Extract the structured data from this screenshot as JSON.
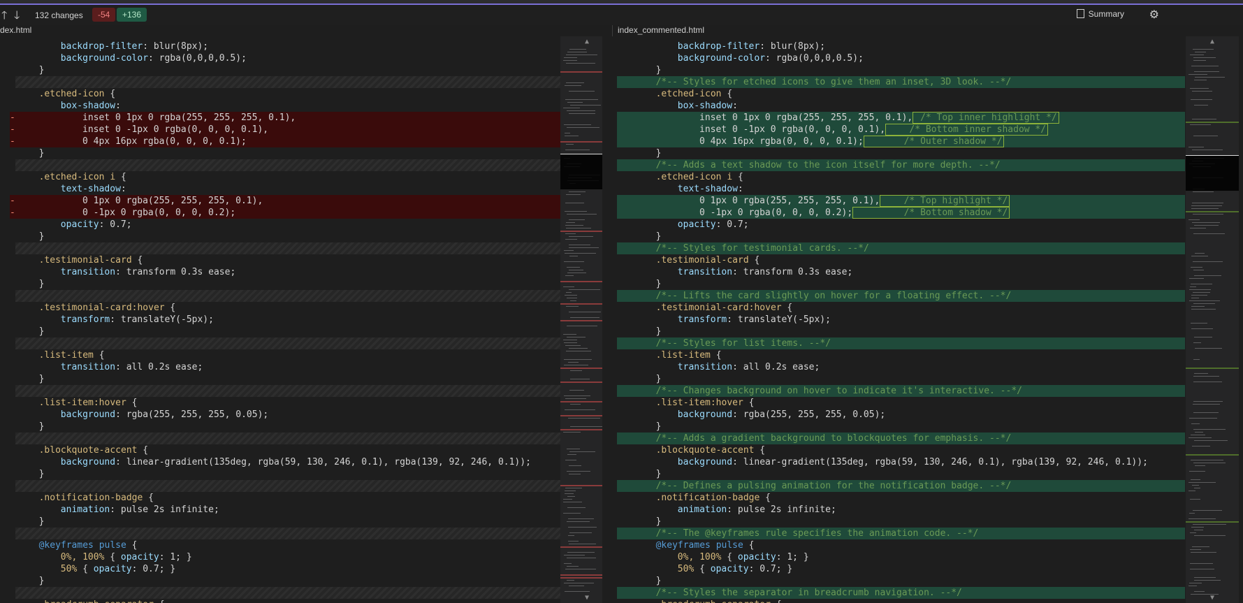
{
  "toolbar": {
    "up_arrow": "🡑",
    "down_arrow": "🡓",
    "changes_label": "132 changes",
    "deletions": "-54",
    "additions": "+136",
    "summary_label": "Summary",
    "settings_icon": "⚙"
  },
  "left": {
    "title": "dex.html",
    "lines": [
      {
        "kind": "ctx",
        "indent": 4,
        "html": "<span class=\"prop\">backdrop-filter</span>: blur(8px);"
      },
      {
        "kind": "ctx",
        "indent": 4,
        "html": "<span class=\"prop\">background-color</span>: rgba(0,0,0,0.5);"
      },
      {
        "kind": "ctx",
        "indent": 3,
        "html": "}"
      },
      {
        "kind": "hatch"
      },
      {
        "kind": "ctx",
        "indent": 3,
        "html": "<span class=\"sel\">.etched-icon</span> {"
      },
      {
        "kind": "ctx",
        "indent": 4,
        "html": "<span class=\"prop\">box-shadow</span>:"
      },
      {
        "kind": "del",
        "indent": 5,
        "html": "inset 0 1px 0 rgba(255, 255, 255, 0.1),"
      },
      {
        "kind": "del",
        "indent": 5,
        "html": "inset 0 -1px 0 rgba(0, 0, 0, 0.1),"
      },
      {
        "kind": "del",
        "indent": 5,
        "html": "0 4px 16px rgba(0, 0, 0, 0.1);"
      },
      {
        "kind": "ctx",
        "indent": 3,
        "html": "}"
      },
      {
        "kind": "hatch"
      },
      {
        "kind": "ctx",
        "indent": 3,
        "html": "<span class=\"sel\">.etched-icon i</span> {"
      },
      {
        "kind": "ctx",
        "indent": 4,
        "html": "<span class=\"prop\">text-shadow</span>:"
      },
      {
        "kind": "del",
        "indent": 5,
        "html": "0 1px 0 rgba(255, 255, 255, 0.1),"
      },
      {
        "kind": "del",
        "indent": 5,
        "html": "0 -1px 0 rgba(0, 0, 0, 0.2);"
      },
      {
        "kind": "ctx",
        "indent": 4,
        "html": "<span class=\"prop\">opacity</span>: 0.7;"
      },
      {
        "kind": "ctx",
        "indent": 3,
        "html": "}"
      },
      {
        "kind": "hatch"
      },
      {
        "kind": "ctx",
        "indent": 3,
        "html": "<span class=\"sel\">.testimonial-card</span> {"
      },
      {
        "kind": "ctx",
        "indent": 4,
        "html": "<span class=\"prop\">transition</span>: transform 0.3s ease;"
      },
      {
        "kind": "ctx",
        "indent": 3,
        "html": "}"
      },
      {
        "kind": "hatch"
      },
      {
        "kind": "ctx",
        "indent": 3,
        "html": "<span class=\"sel\">.testimonial-card:hover</span> {"
      },
      {
        "kind": "ctx",
        "indent": 4,
        "html": "<span class=\"prop\">transform</span>: translateY(-5px);"
      },
      {
        "kind": "ctx",
        "indent": 3,
        "html": "}"
      },
      {
        "kind": "hatch"
      },
      {
        "kind": "ctx",
        "indent": 3,
        "html": "<span class=\"sel\">.list-item</span> {"
      },
      {
        "kind": "ctx",
        "indent": 4,
        "html": "<span class=\"prop\">transition</span>: all 0.2s ease;"
      },
      {
        "kind": "ctx",
        "indent": 3,
        "html": "}"
      },
      {
        "kind": "hatch"
      },
      {
        "kind": "ctx",
        "indent": 3,
        "html": "<span class=\"sel\">.list-item:hover</span> {"
      },
      {
        "kind": "ctx",
        "indent": 4,
        "html": "<span class=\"prop\">background</span>: rgba(255, 255, 255, 0.05);"
      },
      {
        "kind": "ctx",
        "indent": 3,
        "html": "}"
      },
      {
        "kind": "hatch"
      },
      {
        "kind": "ctx",
        "indent": 3,
        "html": "<span class=\"sel\">.blockquote-accent</span> {"
      },
      {
        "kind": "ctx",
        "indent": 4,
        "html": "<span class=\"prop\">background</span>: linear-gradient(135deg, rgba(59, 130, 246, 0.1), rgba(139, 92, 246, 0.1));"
      },
      {
        "kind": "ctx",
        "indent": 3,
        "html": "}"
      },
      {
        "kind": "hatch"
      },
      {
        "kind": "ctx",
        "indent": 3,
        "html": "<span class=\"sel\">.notification-badge</span> {"
      },
      {
        "kind": "ctx",
        "indent": 4,
        "html": "<span class=\"prop\">animation</span>: pulse 2s infinite;"
      },
      {
        "kind": "ctx",
        "indent": 3,
        "html": "}"
      },
      {
        "kind": "hatch"
      },
      {
        "kind": "ctx",
        "indent": 3,
        "html": "<span class=\"at\">@keyframes</span> <span class=\"at\">pulse</span> {"
      },
      {
        "kind": "ctx",
        "indent": 4,
        "html": "<span class=\"sel\">0%, 100%</span> { <span class=\"prop\">opacity</span>: 1; }"
      },
      {
        "kind": "ctx",
        "indent": 4,
        "html": "<span class=\"sel\">50%</span> { <span class=\"prop\">opacity</span>: 0.7; }"
      },
      {
        "kind": "ctx",
        "indent": 3,
        "html": "}"
      },
      {
        "kind": "hatch"
      },
      {
        "kind": "ctx",
        "indent": 3,
        "html": "<span class=\"sel\">.breadcrumb-separator</span> {"
      }
    ]
  },
  "right": {
    "title": "index_commented.html",
    "lines": [
      {
        "kind": "ctx",
        "indent": 4,
        "html": "<span class=\"prop\">backdrop-filter</span>: blur(8px);"
      },
      {
        "kind": "ctx",
        "indent": 4,
        "html": "<span class=\"prop\">background-color</span>: rgba(0,0,0,0.5);"
      },
      {
        "kind": "ctx",
        "indent": 3,
        "html": "}"
      },
      {
        "kind": "add",
        "indent": 3,
        "html": "<span class=\"cmt\">/*-- Styles for etched icons to give them an inset, 3D look. --*/</span>"
      },
      {
        "kind": "ctx",
        "indent": 3,
        "html": "<span class=\"sel\">.etched-icon</span> {"
      },
      {
        "kind": "ctx",
        "indent": 4,
        "html": "<span class=\"prop\">box-shadow</span>:"
      },
      {
        "kind": "add",
        "indent": 5,
        "html": "inset 0 1px 0 rgba(255, 255, 255, 0.1),<span class=\"box cmt\"> /* Top inner highlight */</span>"
      },
      {
        "kind": "add",
        "indent": 5,
        "html": "inset 0 -1px 0 rgba(0, 0, 0, 0.1),<span class=\"box cmt\">    /* Bottom inner shadow */</span>"
      },
      {
        "kind": "add",
        "indent": 5,
        "html": "0 4px 16px rgba(0, 0, 0, 0.1);<span class=\"box cmt\">       /* Outer shadow */</span>"
      },
      {
        "kind": "ctx",
        "indent": 3,
        "html": "}"
      },
      {
        "kind": "add",
        "indent": 3,
        "html": "<span class=\"cmt\">/*-- Adds a text shadow to the icon itself for more depth. --*/</span>"
      },
      {
        "kind": "ctx",
        "indent": 3,
        "html": "<span class=\"sel\">.etched-icon i</span> {"
      },
      {
        "kind": "ctx",
        "indent": 4,
        "html": "<span class=\"prop\">text-shadow</span>:"
      },
      {
        "kind": "add",
        "indent": 5,
        "html": "0 1px 0 rgba(255, 255, 255, 0.1),<span class=\"box cmt\">    /* Top highlight */</span>"
      },
      {
        "kind": "add",
        "indent": 5,
        "html": "0 -1px 0 rgba(0, 0, 0, 0.2);<span class=\"box cmt\">         /* Bottom shadow */</span>"
      },
      {
        "kind": "ctx",
        "indent": 4,
        "html": "<span class=\"prop\">opacity</span>: 0.7;"
      },
      {
        "kind": "ctx",
        "indent": 3,
        "html": "}"
      },
      {
        "kind": "add",
        "indent": 3,
        "html": "<span class=\"cmt\">/*-- Styles for testimonial cards. --*/</span>"
      },
      {
        "kind": "ctx",
        "indent": 3,
        "html": "<span class=\"sel\">.testimonial-card</span> {"
      },
      {
        "kind": "ctx",
        "indent": 4,
        "html": "<span class=\"prop\">transition</span>: transform 0.3s ease;"
      },
      {
        "kind": "ctx",
        "indent": 3,
        "html": "}"
      },
      {
        "kind": "add",
        "indent": 3,
        "html": "<span class=\"cmt\">/*-- Lifts the card slightly on hover for a floating effect. --*/</span>"
      },
      {
        "kind": "ctx",
        "indent": 3,
        "html": "<span class=\"sel\">.testimonial-card:hover</span> {"
      },
      {
        "kind": "ctx",
        "indent": 4,
        "html": "<span class=\"prop\">transform</span>: translateY(-5px);"
      },
      {
        "kind": "ctx",
        "indent": 3,
        "html": "}"
      },
      {
        "kind": "add",
        "indent": 3,
        "html": "<span class=\"cmt\">/*-- Styles for list items. --*/</span>"
      },
      {
        "kind": "ctx",
        "indent": 3,
        "html": "<span class=\"sel\">.list-item</span> {"
      },
      {
        "kind": "ctx",
        "indent": 4,
        "html": "<span class=\"prop\">transition</span>: all 0.2s ease;"
      },
      {
        "kind": "ctx",
        "indent": 3,
        "html": "}"
      },
      {
        "kind": "add",
        "indent": 3,
        "html": "<span class=\"cmt\">/*-- Changes background on hover to indicate it's interactive. --*/</span>"
      },
      {
        "kind": "ctx",
        "indent": 3,
        "html": "<span class=\"sel\">.list-item:hover</span> {"
      },
      {
        "kind": "ctx",
        "indent": 4,
        "html": "<span class=\"prop\">background</span>: rgba(255, 255, 255, 0.05);"
      },
      {
        "kind": "ctx",
        "indent": 3,
        "html": "}"
      },
      {
        "kind": "add",
        "indent": 3,
        "html": "<span class=\"cmt\">/*-- Adds a gradient background to blockquotes for emphasis. --*/</span>"
      },
      {
        "kind": "ctx",
        "indent": 3,
        "html": "<span class=\"sel\">.blockquote-accent</span> {"
      },
      {
        "kind": "ctx",
        "indent": 4,
        "html": "<span class=\"prop\">background</span>: linear-gradient(135deg, rgba(59, 130, 246, 0.1), rgba(139, 92, 246, 0.1));"
      },
      {
        "kind": "ctx",
        "indent": 3,
        "html": "}"
      },
      {
        "kind": "add",
        "indent": 3,
        "html": "<span class=\"cmt\">/*-- Defines a pulsing animation for the notification badge. --*/</span>"
      },
      {
        "kind": "ctx",
        "indent": 3,
        "html": "<span class=\"sel\">.notification-badge</span> {"
      },
      {
        "kind": "ctx",
        "indent": 4,
        "html": "<span class=\"prop\">animation</span>: pulse 2s infinite;"
      },
      {
        "kind": "ctx",
        "indent": 3,
        "html": "}"
      },
      {
        "kind": "add",
        "indent": 3,
        "html": "<span class=\"cmt\">/*-- The @keyframes rule specifies the animation code. --*/</span>"
      },
      {
        "kind": "ctx",
        "indent": 3,
        "html": "<span class=\"at\">@keyframes</span> <span class=\"at\">pulse</span> {"
      },
      {
        "kind": "ctx",
        "indent": 4,
        "html": "<span class=\"sel\">0%, 100%</span> { <span class=\"prop\">opacity</span>: 1; }"
      },
      {
        "kind": "ctx",
        "indent": 4,
        "html": "<span class=\"sel\">50%</span> { <span class=\"prop\">opacity</span>: 0.7; }"
      },
      {
        "kind": "ctx",
        "indent": 3,
        "html": "}"
      },
      {
        "kind": "add",
        "indent": 3,
        "html": "<span class=\"cmt\">/*-- Styles the separator in breadcrumb navigation. --*/</span>"
      },
      {
        "kind": "ctx",
        "indent": 3,
        "html": "<span class=\"sel\">.breadcrumb-separator</span> {"
      }
    ]
  },
  "markers": {
    "del": "-",
    "add": "+"
  },
  "minimap": {
    "up": "▲",
    "down": "▼"
  }
}
